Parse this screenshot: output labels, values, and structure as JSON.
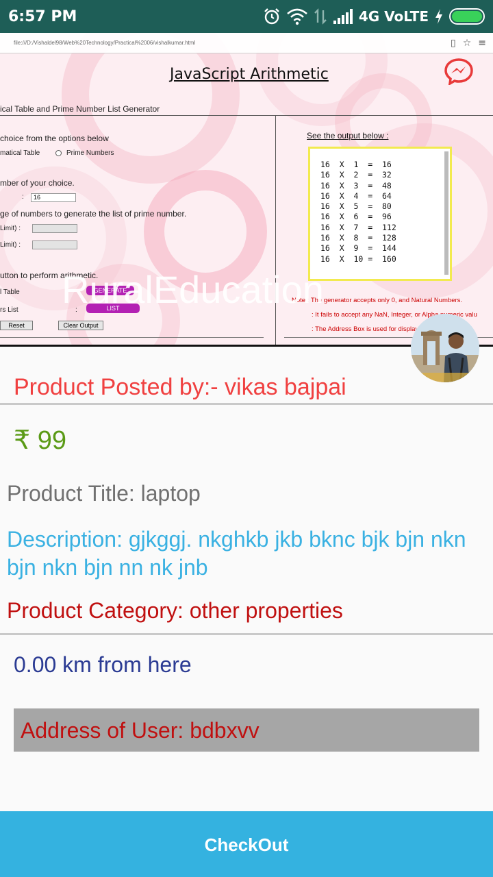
{
  "status_bar": {
    "time": "6:57 PM",
    "network": "4G VoLTE",
    "icons": [
      "alarm-icon",
      "wifi-icon",
      "data-arrows-icon",
      "signal-icon",
      "charging-icon",
      "battery-icon"
    ],
    "battery_color": "#39d15a"
  },
  "product_image": {
    "browser_url": "file:///D:/Vishaldel98/Web%20Technology/Practical%2006/vishalkumar.html",
    "page_title": "JavaScript  Arithmetic",
    "subtitle": "ical Table and Prime Number List Generator",
    "choice_prompt": "choice from the options below",
    "radio_1": "matical Table",
    "radio_2": "Prime Numbers",
    "number_prompt": "mber of your choice.",
    "number_label": ":",
    "number_value": "16",
    "range_prompt": "ge of numbers to generate the list of prime number.",
    "lower_limit_label": "Limit)  :",
    "upper_limit_label": "Limit)  :",
    "button_prompt": "utton to perform arithmetic.",
    "table_label": "l Table",
    "list_label": "rs List",
    "list_colon": ":",
    "generate_button": "GENERATE",
    "list_button": "LIST",
    "reset_button": "Reset",
    "clear_button": "Clear Output",
    "output_label": "See the output below :",
    "output_rows": [
      "16  X  1  =  16",
      "16  X  2  =  32",
      "16  X  3  =  48",
      "16  X  4  =  64",
      "16  X  5  =  80",
      "16  X  6  =  96",
      "16  X  7  =  112",
      "16  X  8  =  128",
      "16  X  9  =  144",
      "16  X  10 =  160"
    ],
    "note_1": "Note : The generator accepts only 0, and Natural Numbers.",
    "note_2": ": It fails to accept any NaN, Integer, or Alpha numeric valu",
    "note_3": ": The Address Box is used for display of the outp",
    "watermark": "RuralEducation"
  },
  "product": {
    "posted_by": "Product Posted by:- vikas bajpai",
    "price_symbol": "₹",
    "price": "99",
    "title": "Product Title: laptop",
    "description": "Description: gjkggj. nkghkb jkb bknc bjk bjn nkn bjn nkn bjn nn nk jnb",
    "category": "Product Category: other properties",
    "distance": "0.00 km from here",
    "address": "Address of User: bdbxvv"
  },
  "checkout": {
    "label": "CheckOut",
    "color": "#34b2e0"
  },
  "colors": {
    "posted_by": "#f04040",
    "price": "#5a9a16",
    "title": "#707070",
    "description": "#3ab1e2",
    "category": "#c01010",
    "distance": "#2b3b93",
    "address_bg": "#a6a6a6",
    "status_bar": "#1e5e57"
  }
}
